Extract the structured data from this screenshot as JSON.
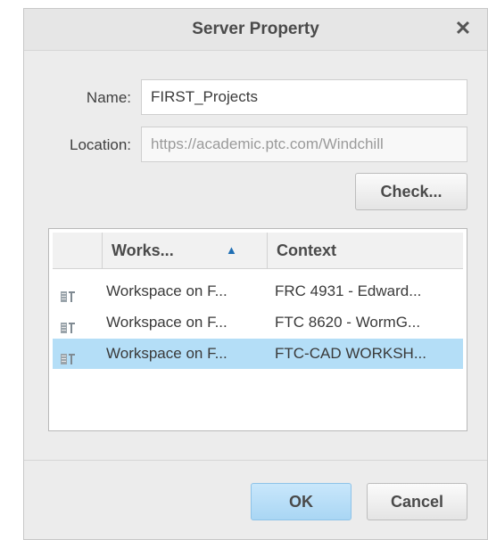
{
  "dialog": {
    "title": "Server Property",
    "close_glyph": "✕"
  },
  "form": {
    "name_label": "Name:",
    "name_value": "FIRST_Projects",
    "location_label": "Location:",
    "location_value": "https://academic.ptc.com/Windchill"
  },
  "buttons": {
    "check": "Check...",
    "ok": "OK",
    "cancel": "Cancel"
  },
  "table": {
    "columns": [
      "Works...",
      "Context"
    ],
    "sort_indicator": "▲",
    "rows": [
      {
        "workspace": "Workspace on F...",
        "context": "FRC 4931 - Edward...",
        "icon": "workspace-icon",
        "selected": false
      },
      {
        "workspace": "Workspace on F...",
        "context": "FTC 8620 - WormG...",
        "icon": "workspace-icon",
        "selected": false
      },
      {
        "workspace": "Workspace on F...",
        "context": "FTC-CAD WORKSH...",
        "icon": "workspace-icon",
        "selected": true
      }
    ]
  },
  "colors": {
    "selection": "#b4def7",
    "primary_button": "#a9d6f4",
    "sort_arrow": "#1f6fb4"
  }
}
